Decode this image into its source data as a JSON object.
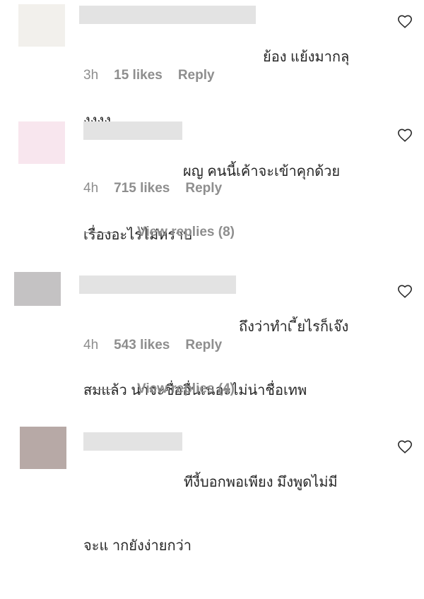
{
  "comments": [
    {
      "text_line1": "ย้อง แย้งมากลุ",
      "text_line2": "งงงง",
      "time": "3h",
      "likes": "15 likes",
      "reply": "Reply",
      "avatar_color": "#f2f0ec"
    },
    {
      "text_line1": "ผญ คนนี้เค้าจะเข้าคุกด้วย",
      "text_line2": "เรื่องอะไรไม่ทราบ",
      "time": "4h",
      "likes": "715 likes",
      "reply": "Reply",
      "view_replies": "View replies (8)",
      "avatar_color": "#f8e6ee"
    },
    {
      "text_line1": "ถึงว่าทำเ ี้ยไรก็เจ๊ง",
      "text_line2": "สมแล้ว น่าจะชื่ออื่นเนอะไม่น่าชื่อเทพ",
      "time": "4h",
      "likes": "543 likes",
      "reply": "Reply",
      "view_replies": "View replies (4)",
      "avatar_color": "#c4c2c3"
    },
    {
      "text_line1": "ทีงี้บอกพอเพียง มึงพูดไม่มี",
      "text_line2": "จะแ ากยังง่ายกว่า",
      "avatar_color": "#b7a9a6"
    }
  ],
  "icons": {
    "like": "heart-outline-icon"
  },
  "colors": {
    "redaction": "#e3e3e3",
    "meta_text": "#8e8e8e"
  }
}
